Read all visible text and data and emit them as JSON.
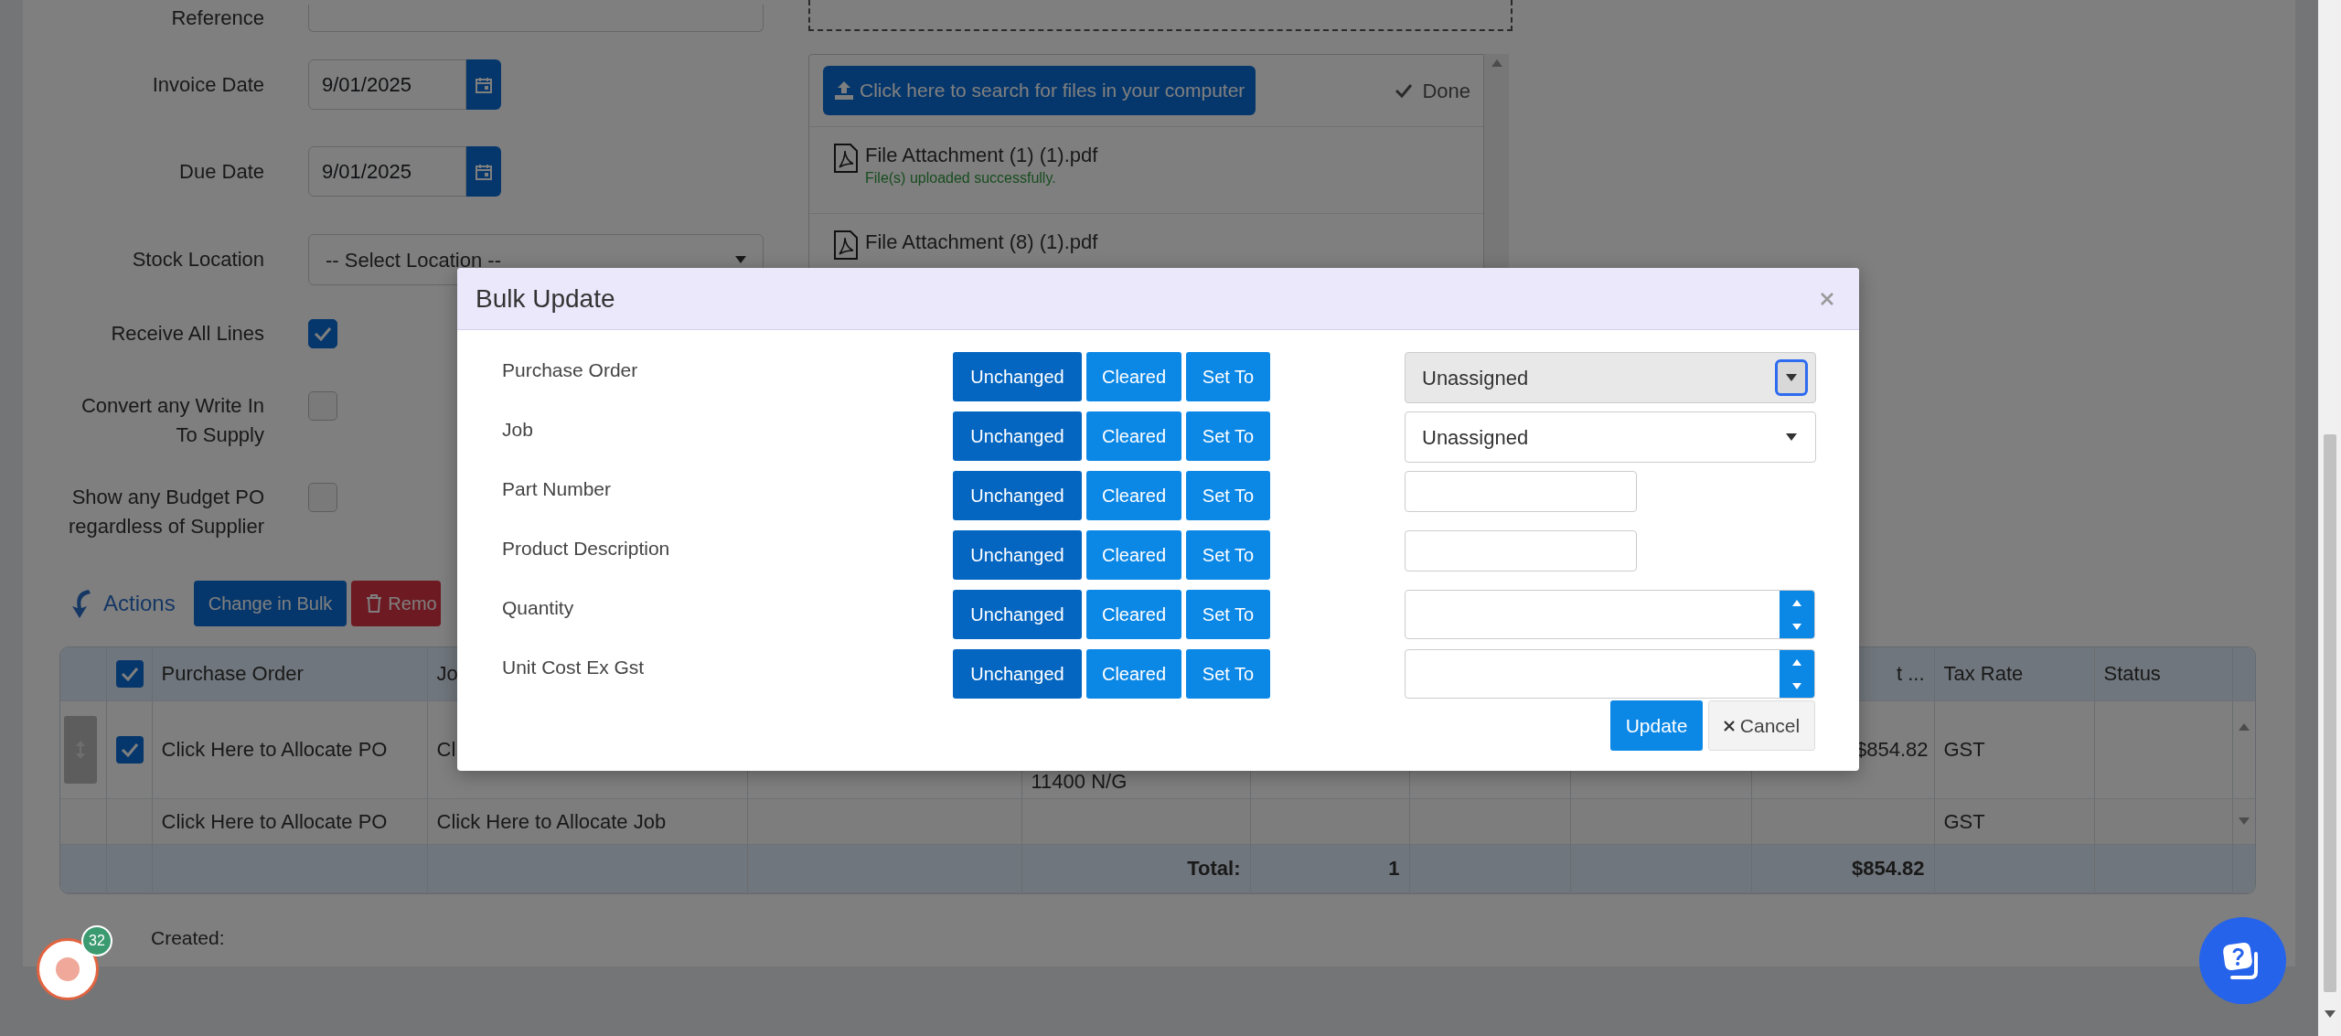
{
  "form": {
    "reference_label": "Reference",
    "fields": [
      {
        "kind": "date",
        "label": "Invoice Date",
        "value": "9/01/2025"
      },
      {
        "kind": "date",
        "label": "Due Date",
        "value": "9/01/2025"
      },
      {
        "kind": "select",
        "label": "Stock Location",
        "value": "-- Select Location --"
      },
      {
        "kind": "checkbox",
        "label": "Receive All Lines",
        "checked": true
      },
      {
        "kind": "checkbox",
        "label": "Convert any Write In To Supply",
        "checked": false
      },
      {
        "kind": "checkbox",
        "label": "Show any Budget PO regardless of Supplier",
        "checked": false
      }
    ]
  },
  "attachments": {
    "upload_button": "Click here to search for files in your computer",
    "done": "Done",
    "files": [
      {
        "name": "File Attachment (1) (1).pdf",
        "status": "File(s) uploaded successfully."
      },
      {
        "name": "File Attachment (8) (1).pdf"
      }
    ]
  },
  "actions": {
    "title": "Actions",
    "buttons": [
      {
        "kind": "primary",
        "label": "Change in Bulk"
      },
      {
        "kind": "danger",
        "label": "Remo"
      }
    ]
  },
  "table": {
    "header_checked": true,
    "columns": {
      "purchase_order": "Purchase Order",
      "job": "Jo",
      "column_9": "t ...",
      "tax_rate": "Tax Rate",
      "status": "Status"
    },
    "rows": [
      {
        "kind": "item",
        "checked": true,
        "cells": {
          "purchase_order": "Click Here to Allocate PO",
          "job": "Cl",
          "column_5": "11400 N/G",
          "column_9": "$854.82",
          "tax_rate": "GST"
        }
      },
      {
        "kind": "plain",
        "cells": {
          "purchase_order": "Click Here to Allocate PO",
          "job": "Click Here to Allocate Job",
          "tax_rate": "GST"
        }
      }
    ],
    "total": {
      "column_5": "Total:",
      "column_6": "1",
      "column_9": "$854.82"
    }
  },
  "footer": {
    "created_label": "Created:"
  },
  "notification_count": "32",
  "bulk_update": {
    "title": "Bulk Update",
    "rows": [
      {
        "label": "Purchase Order",
        "modes": [
          {
            "label": "Unchanged",
            "selected": true
          },
          {
            "label": "Cleared",
            "selected": false
          },
          {
            "label": "Set To",
            "selected": false
          }
        ],
        "input": {
          "kind": "select",
          "value": "Unassigned",
          "disabled": true,
          "focused": true
        }
      },
      {
        "label": "Job",
        "modes": [
          {
            "label": "Unchanged",
            "selected": true
          },
          {
            "label": "Cleared",
            "selected": false
          },
          {
            "label": "Set To",
            "selected": false
          }
        ],
        "input": {
          "kind": "select",
          "value": "Unassigned",
          "disabled": false,
          "focused": false
        }
      },
      {
        "label": "Part Number",
        "modes": [
          {
            "label": "Unchanged",
            "selected": true
          },
          {
            "label": "Cleared",
            "selected": false
          },
          {
            "label": "Set To",
            "selected": false
          }
        ],
        "input": {
          "kind": "text"
        }
      },
      {
        "label": "Product Description",
        "modes": [
          {
            "label": "Unchanged",
            "selected": true
          },
          {
            "label": "Cleared",
            "selected": false
          },
          {
            "label": "Set To",
            "selected": false
          }
        ],
        "input": {
          "kind": "text"
        }
      },
      {
        "label": "Quantity",
        "modes": [
          {
            "label": "Unchanged",
            "selected": true
          },
          {
            "label": "Cleared",
            "selected": false
          },
          {
            "label": "Set To",
            "selected": false
          }
        ],
        "input": {
          "kind": "number"
        }
      },
      {
        "label": "Unit Cost Ex Gst",
        "modes": [
          {
            "label": "Unchanged",
            "selected": true
          },
          {
            "label": "Cleared",
            "selected": false
          },
          {
            "label": "Set To",
            "selected": false
          }
        ],
        "input": {
          "kind": "number"
        }
      }
    ],
    "update_button": "Update",
    "cancel_button": "Cancel"
  }
}
